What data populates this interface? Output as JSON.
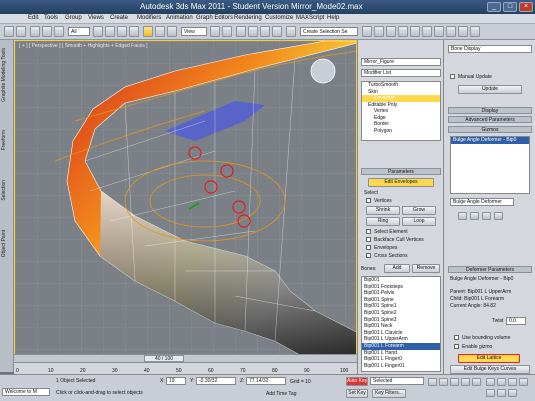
{
  "window": {
    "title": "Autodesk 3ds Max  2011   -  Student Version      Mirror_Mode02.max",
    "controls": [
      "_",
      "□",
      "×"
    ]
  },
  "menu": {
    "items": [
      "Edit",
      "Tools",
      "Group",
      "Views",
      "Create",
      "Modifiers",
      "Animation",
      "Graph Editors",
      "Rendering",
      "Customize",
      "MAXScript",
      "Help"
    ]
  },
  "toolbar": {
    "view_dropdown": "View",
    "selection_set": "Create Selection Se"
  },
  "ribbon": {
    "tabs": [
      "Graphite Modeling Tools",
      "Freeform",
      "Selection",
      "Object Paint"
    ]
  },
  "viewport": {
    "label": "[ + ] [ Perspective ] [ Smooth + Highlights + Edged Faces ]",
    "slider_position": "40 / 100"
  },
  "timeline": {
    "ticks": [
      "0",
      "10",
      "20",
      "30",
      "40",
      "50",
      "60",
      "70",
      "80",
      "90",
      "100"
    ]
  },
  "command_panel": {
    "object_name": "Mirror_Figure",
    "modifier_list": "Modifier List",
    "stack": [
      "TurboSmooth",
      "Skin",
      "Envelope",
      "Editable Poly",
      "Vertex",
      "Edge",
      "Border",
      "Polygon"
    ],
    "stack_selected": "Envelope",
    "parameters_header": "Parameters",
    "edit_envelopes_button": "Edit Envelopes",
    "select_label": "Select",
    "vertices_label": "Vertices",
    "shrink": "Shrink",
    "grow": "Grow",
    "ring": "Ring",
    "loop": "Loop",
    "select_element": "Select Element",
    "backface_cull": "Backface Cull Vertices",
    "envelopes_label": "Envelopes",
    "cross_sections": "Cross Sections",
    "bones_label": "Bones:",
    "add_button": "Add",
    "remove_button": "Remove",
    "bones": [
      "Bip001",
      "Bip001 Footsteps",
      "Bip001 Pelvis",
      "Bip001 Spine",
      "Bip001 Spine1",
      "Bip001 Spine2",
      "Bip001 Spine3",
      "Bip001 Neck",
      "Bip001 L Clavicle",
      "Bip001 L UpperArm",
      "Bip001 L Forearm",
      "Bip001 L Hand",
      "Bip001 L Finger0",
      "Bip001 L Finger01"
    ],
    "bones_selected": "Bip001 L Forearm"
  },
  "right_panel": {
    "display_dropdown": "Bone Display",
    "manual_update": "Manual Update",
    "update_button": "Update",
    "display_header": "Display",
    "advanced_header": "Advanced Parameters",
    "gizmos_header": "Gizmos",
    "gizmo_item": "Bulge Angle Deformer - Bip0",
    "gizmo_dropdown": "Bulge Angle Deformer",
    "deformer_header": "Deformer Parameters",
    "deformer_title": "Bulge Angle Deformer - Bip0",
    "parent_label": "Parent: Bip001 L UpperArm",
    "child_label": "Child: Bip001 L Forearm",
    "angle_label": "Current Angle: 84.82",
    "twist_label": "Twist",
    "twist_value": "0.0",
    "use_bounding": "Use bounding volume",
    "enable_gizmo": "Enable gizmo",
    "edit_lattice_button": "Edit Lattice",
    "edit_bulge_button": "Edit Bulge Keys Curves"
  },
  "status": {
    "script": "Welcome to M",
    "selected": "1 Object Selected",
    "prompt": "Click or click-and-drag to select objects",
    "x_label": "X:",
    "x_value": "19",
    "y_label": "Y:",
    "y_value": "-0.30/32",
    "z_label": "Z:",
    "z_value": "77.14/32",
    "grid": "Grid = 10",
    "add_time_tag": "Add Time Tag",
    "autokey": "Auto Key",
    "selected_dropdown": "Selected",
    "set_key": "Set Key",
    "key_filters": "Key Filters..."
  },
  "colors": {
    "accent_yellow": "#ffd84d",
    "selection_blue": "#2f5fa8",
    "gizmo_red": "#e21d1d"
  }
}
